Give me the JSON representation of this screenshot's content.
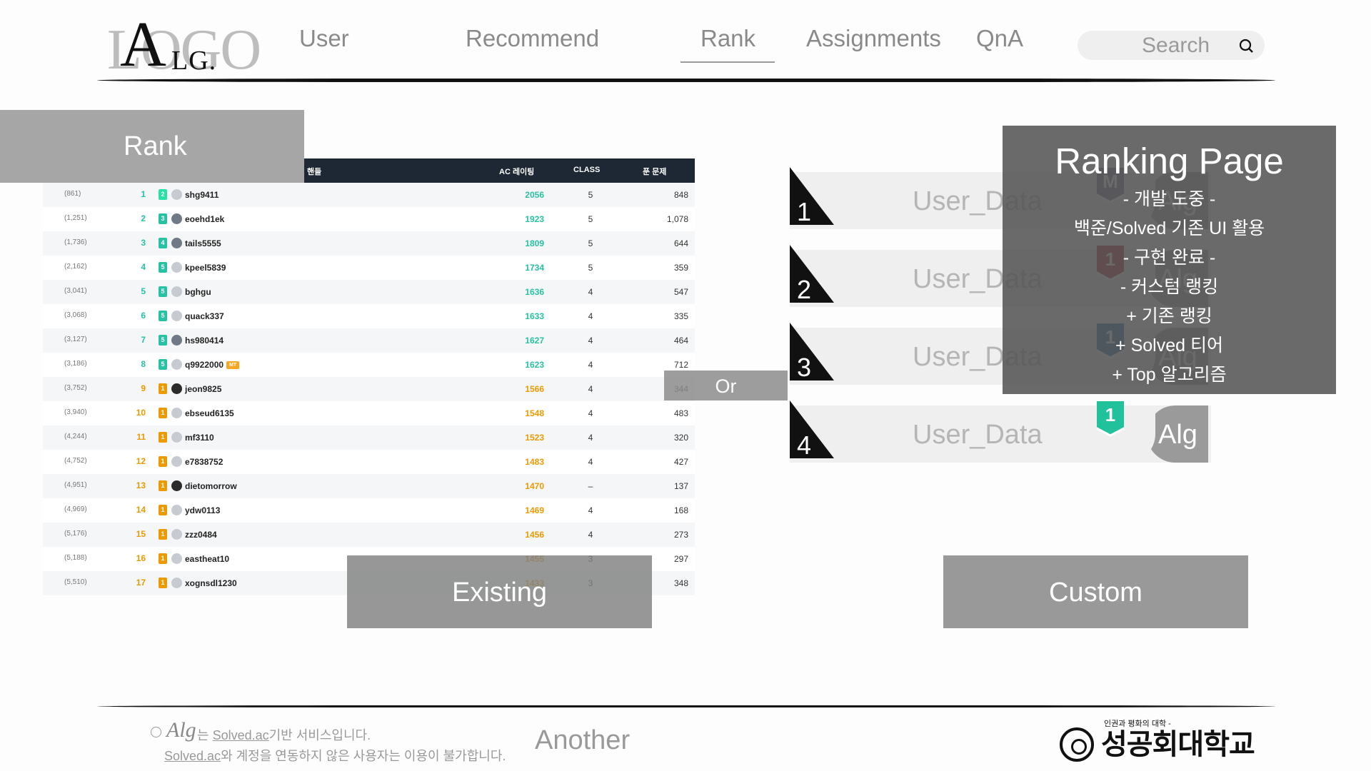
{
  "logo": {
    "bg_text": "LOGO",
    "fg_a": "A",
    "fg_lg": "LG."
  },
  "nav": {
    "user": "User",
    "recommend": "Recommend",
    "rank": "Rank",
    "assignments": "Assignments",
    "qna": "QnA"
  },
  "search": {
    "placeholder": "Search"
  },
  "rank_panel": {
    "label": "Rank"
  },
  "table": {
    "headers": {
      "rank": "#",
      "handle": "핸들",
      "rating": "AC 레이팅",
      "class": "CLASS",
      "solved": "푼 문제"
    },
    "rows": [
      {
        "prev": "(861)",
        "rank": "1",
        "tier": "2",
        "tier_color": "#27e2a4",
        "handle": "shg9411",
        "rating": "2056",
        "rating_color": "#27c2a4",
        "class": "5",
        "solved": "848"
      },
      {
        "prev": "(1,251)",
        "rank": "2",
        "tier": "3",
        "tier_color": "#27c2a4",
        "handle": "eoehd1ek",
        "rating": "1923",
        "rating_color": "#27c2a4",
        "class": "5",
        "solved": "1,078"
      },
      {
        "prev": "(1,736)",
        "rank": "3",
        "tier": "4",
        "tier_color": "#27c2a4",
        "handle": "tails5555",
        "rating": "1809",
        "rating_color": "#27c2a4",
        "class": "5",
        "solved": "644"
      },
      {
        "prev": "(2,162)",
        "rank": "4",
        "tier": "5",
        "tier_color": "#27c2a4",
        "handle": "kpeel5839",
        "rating": "1734",
        "rating_color": "#27c2a4",
        "class": "5",
        "solved": "359"
      },
      {
        "prev": "(3,041)",
        "rank": "5",
        "tier": "5",
        "tier_color": "#27c2a4",
        "handle": "bghgu",
        "rating": "1636",
        "rating_color": "#27c2a4",
        "class": "4",
        "solved": "547"
      },
      {
        "prev": "(3,068)",
        "rank": "6",
        "tier": "5",
        "tier_color": "#27c2a4",
        "handle": "quack337",
        "rating": "1633",
        "rating_color": "#27c2a4",
        "class": "4",
        "solved": "335"
      },
      {
        "prev": "(3,127)",
        "rank": "7",
        "tier": "5",
        "tier_color": "#27c2a4",
        "handle": "hs980414",
        "rating": "1627",
        "rating_color": "#27c2a4",
        "class": "4",
        "solved": "464"
      },
      {
        "prev": "(3,186)",
        "rank": "8",
        "tier": "5",
        "tier_color": "#27c2a4",
        "handle": "q9922000",
        "rating": "1623",
        "rating_color": "#27c2a4",
        "class": "4",
        "solved": "712",
        "badge": "MT"
      },
      {
        "prev": "(3,752)",
        "rank": "9",
        "tier": "1",
        "tier_color": "#ec9a00",
        "handle": "jeon9825",
        "rating": "1566",
        "rating_color": "#ec9a00",
        "class": "4",
        "solved": "344"
      },
      {
        "prev": "(3,940)",
        "rank": "10",
        "tier": "1",
        "tier_color": "#ec9a00",
        "handle": "ebseud6135",
        "rating": "1548",
        "rating_color": "#ec9a00",
        "class": "4",
        "solved": "483"
      },
      {
        "prev": "(4,244)",
        "rank": "11",
        "tier": "1",
        "tier_color": "#ec9a00",
        "handle": "mf3110",
        "rating": "1523",
        "rating_color": "#ec9a00",
        "class": "4",
        "solved": "320"
      },
      {
        "prev": "(4,752)",
        "rank": "12",
        "tier": "1",
        "tier_color": "#ec9a00",
        "handle": "e7838752",
        "rating": "1483",
        "rating_color": "#ec9a00",
        "class": "4",
        "solved": "427"
      },
      {
        "prev": "(4,951)",
        "rank": "13",
        "tier": "1",
        "tier_color": "#ec9a00",
        "handle": "dietomorrow",
        "rating": "1470",
        "rating_color": "#ec9a00",
        "class": "–",
        "solved": "137"
      },
      {
        "prev": "(4,969)",
        "rank": "14",
        "tier": "1",
        "tier_color": "#ec9a00",
        "handle": "ydw0113",
        "rating": "1469",
        "rating_color": "#ec9a00",
        "class": "4",
        "solved": "168"
      },
      {
        "prev": "(5,176)",
        "rank": "15",
        "tier": "1",
        "tier_color": "#ec9a00",
        "handle": "zzz0484",
        "rating": "1456",
        "rating_color": "#ec9a00",
        "class": "4",
        "solved": "273"
      },
      {
        "prev": "(5,188)",
        "rank": "16",
        "tier": "1",
        "tier_color": "#ec9a00",
        "handle": "eastheat10",
        "rating": "1455",
        "rating_color": "#ec9a00",
        "class": "3",
        "solved": "297"
      },
      {
        "prev": "(5,510)",
        "rank": "17",
        "tier": "1",
        "tier_color": "#ec9a00",
        "handle": "xognsdl1230",
        "rating": "1433",
        "rating_color": "#ec9a00",
        "class": "3",
        "solved": "348"
      }
    ]
  },
  "buttons": {
    "existing": "Existing",
    "custom": "Custom",
    "or": "Or",
    "another": "Another"
  },
  "cards": [
    {
      "num": "1",
      "user": "User_Data",
      "alg": "Alg",
      "badge_text": "M",
      "badge_color": "#6d6d8a"
    },
    {
      "num": "2",
      "user": "User_Data",
      "alg": "Alg",
      "badge_text": "1",
      "badge_color": "#a8122a"
    },
    {
      "num": "3",
      "user": "User_Data",
      "alg": "Alg",
      "badge_text": "1",
      "badge_color": "#1f5e9a"
    },
    {
      "num": "4",
      "user": "User_Data",
      "alg": "Alg",
      "badge_text": "1",
      "badge_color": "#21c29b"
    }
  ],
  "note": {
    "title": "Ranking Page",
    "lines": [
      "- 개발 도중 -",
      "백준/Solved 기존 UI 활용",
      "- 구현 완료 -",
      "- 커스텀 랭킹",
      "+ 기존 랭킹",
      "+ Solved 티어",
      "+ Top 알고리즘"
    ]
  },
  "footer": {
    "alg_mark": "Alg",
    "line1_prefix": "는 ",
    "line1_link": "Solved.ac",
    "line1_suffix": "기반 서비스입니다.",
    "line2_link": "Solved.ac",
    "line2_suffix": "와 계정을 연동하지 않은 사용자는 이용이 불가합니다."
  },
  "university": {
    "sub": "인권과 평화의 대학 -",
    "name": "성공회대학교"
  }
}
